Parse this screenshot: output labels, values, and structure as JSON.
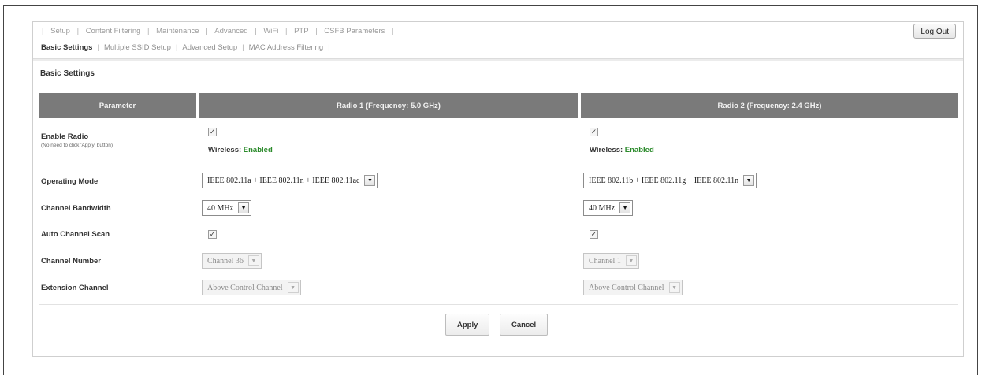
{
  "top_nav": {
    "items": [
      "Setup",
      "Content Filtering",
      "Maintenance",
      "Advanced",
      "WiFi",
      "PTP",
      "CSFB Parameters"
    ],
    "logout_label": "Log Out"
  },
  "sub_nav": {
    "items": [
      "Basic Settings",
      "Multiple SSID Setup",
      "Advanced Setup",
      "MAC Address Filtering"
    ],
    "active": "Basic Settings"
  },
  "section_title": "Basic Settings",
  "table": {
    "headers": [
      "Parameter",
      "Radio 1 (Frequency: 5.0 GHz)",
      "Radio 2 (Frequency: 2.4 GHz)"
    ],
    "enable_radio": {
      "label": "Enable Radio",
      "note": "(No need to click 'Apply' button)",
      "radio1_checked": true,
      "radio2_checked": true,
      "status_prefix": "Wireless:",
      "radio1_status": "Enabled",
      "radio2_status": "Enabled"
    },
    "operating_mode": {
      "label": "Operating Mode",
      "radio1": "IEEE 802.11a + IEEE 802.11n + IEEE 802.11ac",
      "radio2": "IEEE 802.11b + IEEE 802.11g + IEEE 802.11n"
    },
    "channel_bandwidth": {
      "label": "Channel Bandwidth",
      "radio1": "40 MHz",
      "radio2": "40 MHz"
    },
    "auto_channel_scan": {
      "label": "Auto Channel Scan",
      "radio1_checked": true,
      "radio2_checked": true
    },
    "channel_number": {
      "label": "Channel Number",
      "radio1": "Channel 36",
      "radio2": "Channel 1"
    },
    "extension_channel": {
      "label": "Extension Channel",
      "radio1": "Above Control Channel",
      "radio2": "Above Control Channel"
    }
  },
  "buttons": {
    "apply": "Apply",
    "cancel": "Cancel"
  },
  "colors": {
    "header_bg": "#7a7a7a",
    "enabled_green": "#2a8a2a"
  }
}
